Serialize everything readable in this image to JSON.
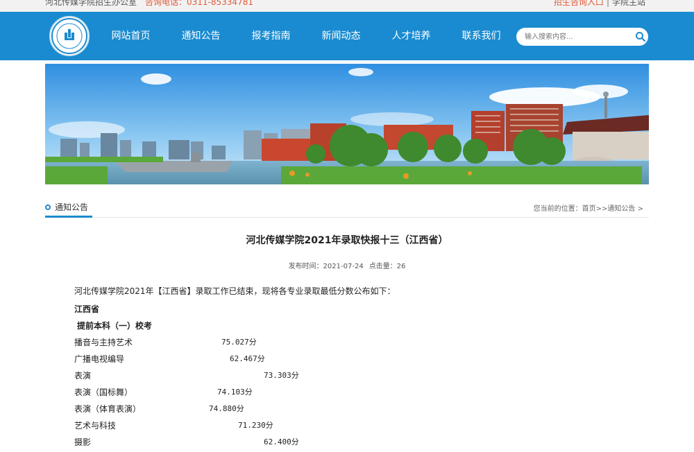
{
  "topbar": {
    "office": "河北传媒学院招生办公室",
    "phone": "咨询电话：0311-85334781",
    "enroll_link": "招生咨询入口",
    "separator": "|",
    "main_site_link": "学院主站"
  },
  "nav": {
    "items": [
      "网站首页",
      "通知公告",
      "报考指南",
      "新闻动态",
      "人才培养",
      "联系我们"
    ],
    "search_placeholder": "输入搜索内容..."
  },
  "section": {
    "title": "通知公告",
    "breadcrumb": "您当前的位置：首页>>通知公告 >"
  },
  "article": {
    "title": "河北传媒学院2021年录取快报十三（江西省）",
    "published": "发布时间：2021-07-24",
    "views": "点击量：26",
    "intro": "河北传媒学院2021年【江西省】录取工作已结束，现将各专业录取最低分数公布如下：",
    "province": "江西省",
    "batch": "提前本科（一）校考",
    "rows": [
      {
        "major": "播音与主持艺术",
        "score": "75.027分"
      },
      {
        "major": "广播电视编导",
        "score": "62.467分"
      },
      {
        "major": "表演",
        "score": "73.303分"
      },
      {
        "major": "表演（国标舞）",
        "score": "74.103分"
      },
      {
        "major": "表演（体育表演）",
        "score": "74.880分"
      },
      {
        "major": "艺术与科技",
        "score": "71.230分"
      },
      {
        "major": "摄影",
        "score": "62.400分"
      }
    ]
  },
  "colors": {
    "brand_blue": "#1a8bd0",
    "accent_red": "#e05a3a"
  }
}
